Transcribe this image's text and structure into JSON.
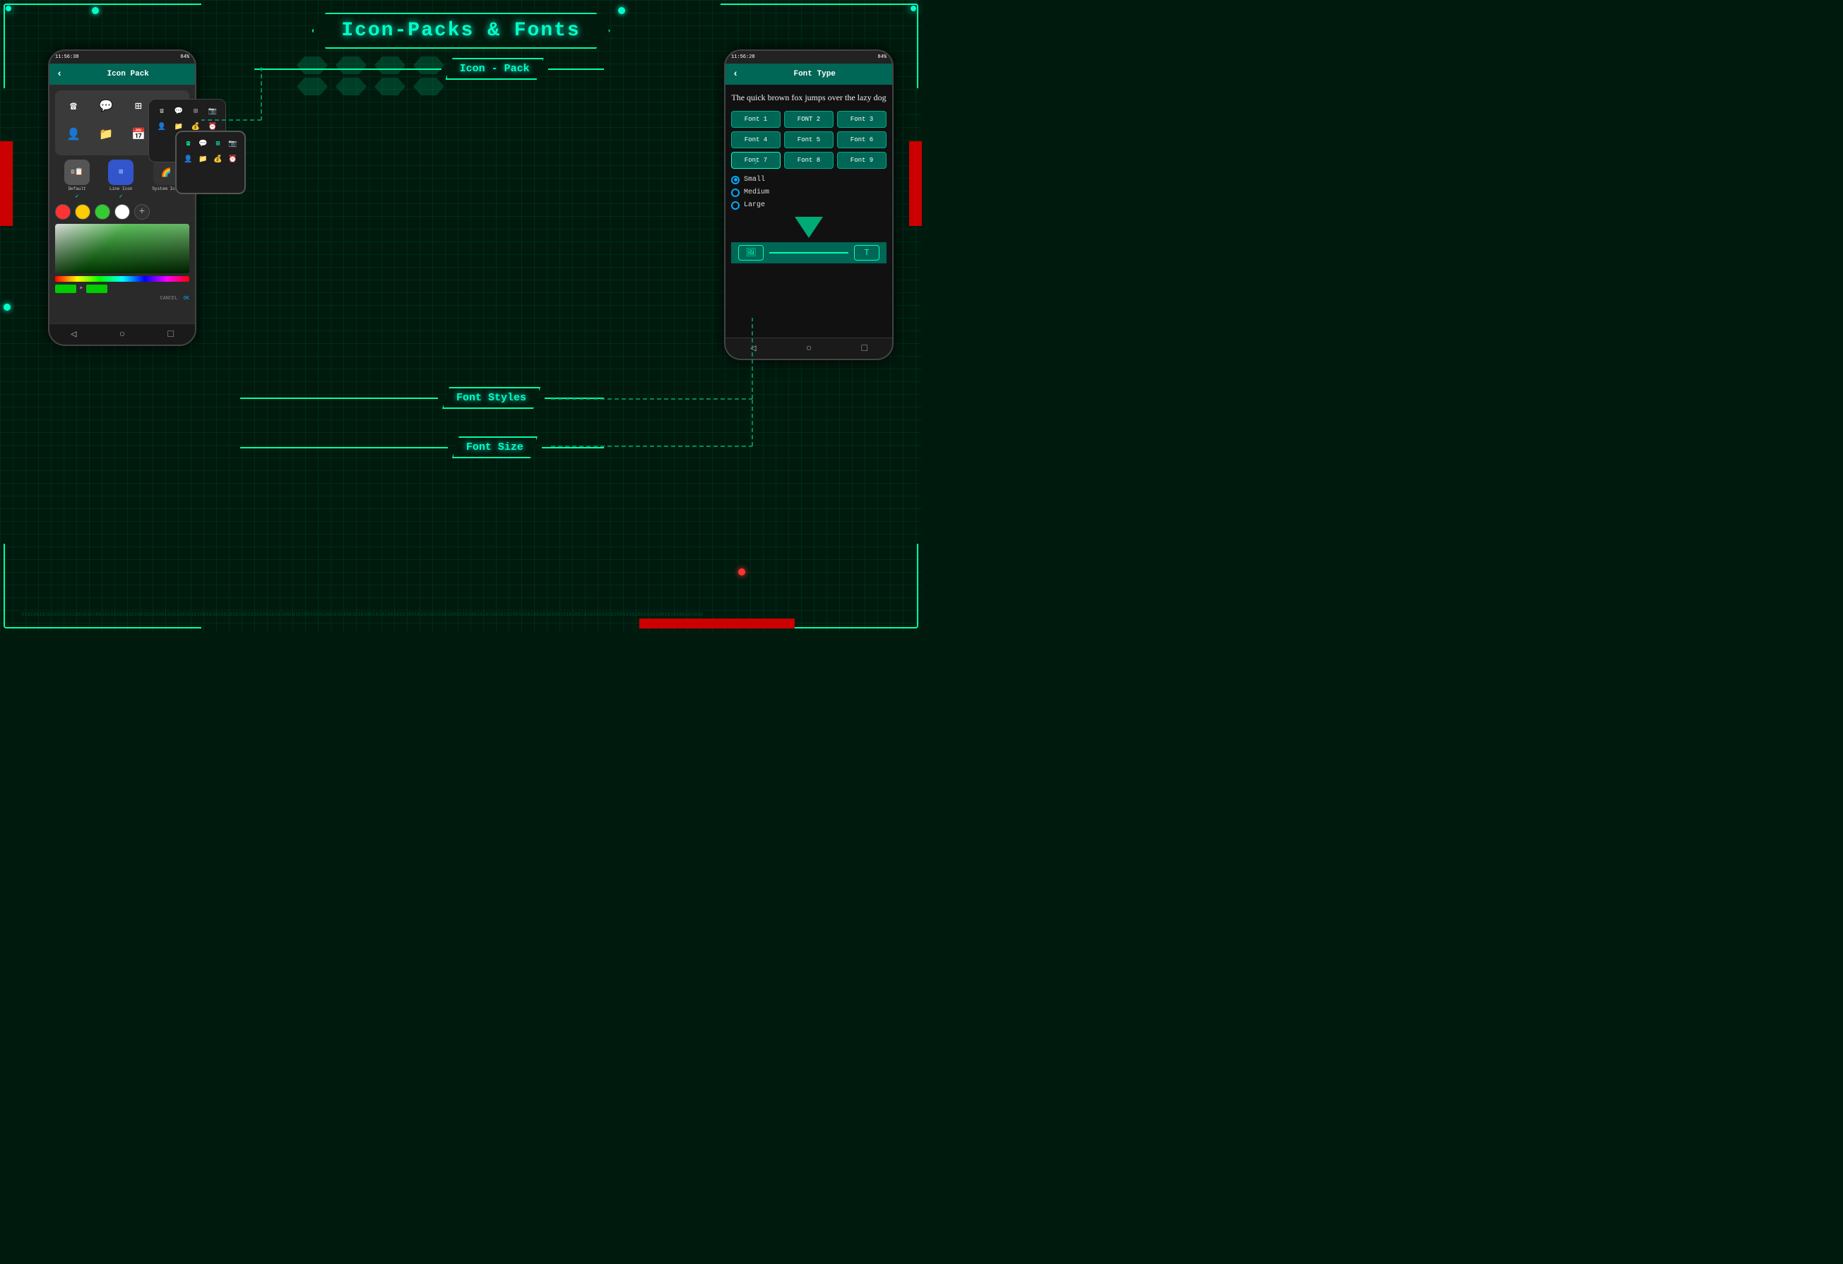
{
  "page": {
    "title": "Icon-Packs & Fonts",
    "background_color": "#011a0e"
  },
  "left_phone": {
    "status_bar": {
      "time": "11:56:38",
      "battery": "84%"
    },
    "header": {
      "back_label": "‹",
      "title": "Icon Pack"
    },
    "icon_types": [
      {
        "label": "Default",
        "check": "✓",
        "type": "default"
      },
      {
        "label": "Line Icon",
        "check": "✓",
        "type": "line"
      },
      {
        "label": "System Icon",
        "check": "",
        "type": "system"
      }
    ],
    "colors": [
      "#ff3333",
      "#ffcc00",
      "#33cc33",
      "#ffffff"
    ],
    "add_color_label": "+",
    "cancel_label": "CANCEL",
    "ok_label": "OK",
    "nav": [
      "◁",
      "○",
      "□"
    ]
  },
  "right_phone": {
    "status_bar": {
      "time": "11:56:28",
      "battery": "84%"
    },
    "header": {
      "back_label": "‹",
      "title": "Font Type"
    },
    "preview_text": "The quick brown fox jumps over the lazy dog",
    "fonts": [
      {
        "label": "Font 1",
        "selected": false
      },
      {
        "label": "FONT 2",
        "selected": false
      },
      {
        "label": "Font 3",
        "selected": false
      },
      {
        "label": "Font 4",
        "selected": false
      },
      {
        "label": "Font 5",
        "selected": false
      },
      {
        "label": "Font 6",
        "selected": false
      },
      {
        "label": "Font 7",
        "selected": true
      },
      {
        "label": "Font 8",
        "selected": false
      },
      {
        "label": "Font 9",
        "selected": false
      }
    ],
    "font_sizes": [
      {
        "label": "Small",
        "selected": true
      },
      {
        "label": "Medium",
        "selected": false
      },
      {
        "label": "Large",
        "selected": false
      }
    ],
    "bottom_buttons": [
      "🖼",
      "T"
    ],
    "nav": [
      "◁",
      "○",
      "□"
    ]
  },
  "labels": {
    "icon_pack": "Icon - Pack",
    "font_styles": "Font Styles",
    "font_size": "Font Size"
  },
  "overlay_panels": {
    "mid_icons": [
      "☎",
      "💬",
      "⊞",
      "📷",
      "👤",
      "📁",
      "💰",
      "⏰"
    ],
    "front_icons": [
      "☎",
      "💬",
      "⊞",
      "📷",
      "👤",
      "📁",
      "💰",
      "⏰"
    ]
  }
}
